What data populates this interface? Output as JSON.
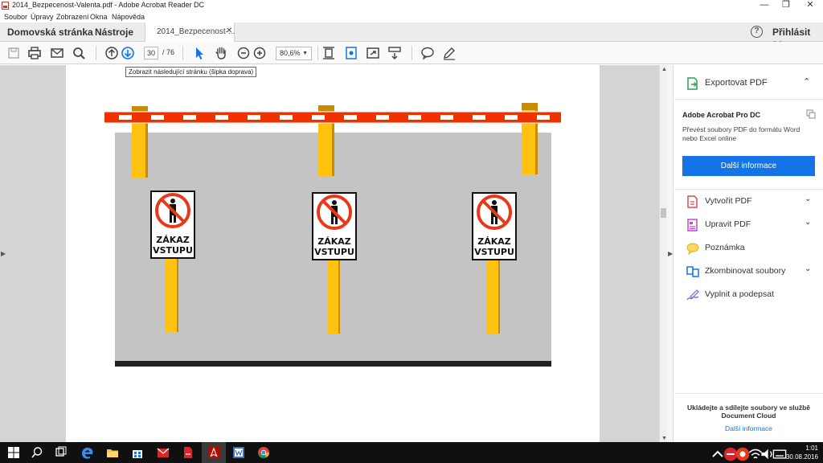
{
  "window": {
    "title": "2014_Bezpecenost-Valenta.pdf - Adobe Acrobat Reader DC",
    "minimize": "—",
    "maximize": "❐",
    "close": "✕"
  },
  "menu": [
    "Soubor",
    "Úpravy",
    "Zobrazení",
    "Okna",
    "Nápověda"
  ],
  "tabs": {
    "home": "Domovská stránka",
    "tools": "Nástroje",
    "document": "2014_Bezpecenost-...",
    "document_close": "✕",
    "help_icon": "?",
    "sign_in": "Přihlásit se"
  },
  "toolbar": {
    "icons": [
      "save-icon",
      "print-icon",
      "email-icon",
      "search-icon",
      "prev-page-icon",
      "next-page-icon",
      "select-icon",
      "hand-icon",
      "zoom-out-icon",
      "zoom-in-icon",
      "fit-page-icon",
      "read-mode-icon",
      "fullscreen-icon",
      "scroll-icon",
      "comment-icon",
      "highlight-icon"
    ],
    "page_current": "30",
    "page_total": "/ 76",
    "zoom": "80,6%",
    "zoom_arrow": "▼",
    "tooltip": "Zobrazit následující stránku (šipka doprava)"
  },
  "document": {
    "sign_text_line1": "ZÁKAZ",
    "sign_text_line2": "VSTUPU",
    "colors": {
      "barrier_red": "#ee3300",
      "post_yellow": "#ffc20e",
      "ground_gray": "#c4c4c4",
      "sign_red": "#e8391b"
    }
  },
  "right_panel": {
    "export_label": "Exportovat PDF",
    "export_chevron": "⌃",
    "product": "Adobe Acrobat Pro DC",
    "product_desc": "Převést soubory PDF do formátu Word nebo Excel online",
    "more_info_button": "Další informace",
    "tools": [
      {
        "label": "Vytvořit PDF",
        "chevron": "⌄",
        "icon": "create-pdf-icon"
      },
      {
        "label": "Upravit PDF",
        "chevron": "⌄",
        "icon": "edit-pdf-icon"
      },
      {
        "label": "Poznámka",
        "chevron": "",
        "icon": "comment-icon"
      },
      {
        "label": "Zkombinovat soubory",
        "chevron": "⌄",
        "icon": "combine-icon"
      },
      {
        "label": "Vyplnit a podepsat",
        "chevron": "",
        "icon": "sign-icon"
      }
    ],
    "cloud_text": "Ukládejte a sdílejte soubory ve službě Document Cloud",
    "cloud_link": "Další informace"
  },
  "taskbar": {
    "time": "1:01",
    "date": "30.08.2016",
    "accent": "#1473e6"
  }
}
